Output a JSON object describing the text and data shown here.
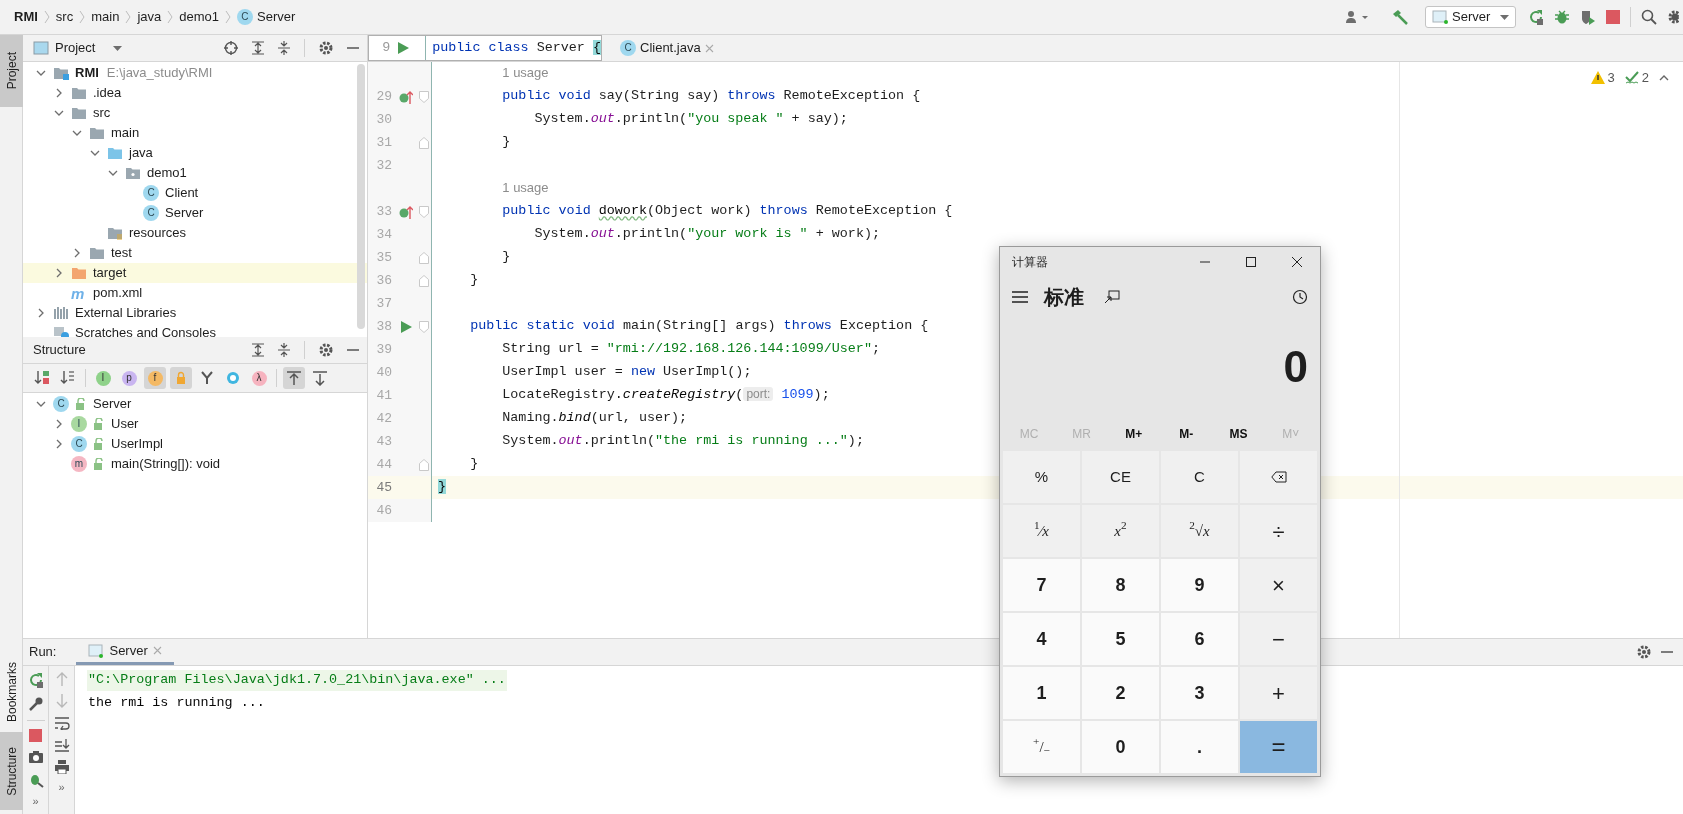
{
  "breadcrumbs": [
    {
      "text": "RMI",
      "kind": "project"
    },
    {
      "text": "src",
      "kind": "folder"
    },
    {
      "text": "main",
      "kind": "folder"
    },
    {
      "text": "java",
      "kind": "folder"
    },
    {
      "text": "demo1",
      "kind": "folder"
    },
    {
      "text": "Server",
      "kind": "class",
      "glyph": "C"
    }
  ],
  "toolbar": {
    "run_config": "Server"
  },
  "left_strip": {
    "top": [
      {
        "label": "Project",
        "selected": true
      }
    ],
    "bottom": [
      {
        "label": "Bookmarks",
        "selected": false
      },
      {
        "label": "Structure",
        "selected": true
      }
    ]
  },
  "project_panel": {
    "title": "Project",
    "tree": [
      {
        "text": "RMI",
        "kind": "project",
        "path": "E:\\java_study\\RMI",
        "expanded": true,
        "children": [
          {
            "text": ".idea",
            "kind": "folder",
            "expanded": false
          },
          {
            "text": "src",
            "kind": "folder",
            "expanded": true,
            "children": [
              {
                "text": "main",
                "kind": "folder",
                "expanded": true,
                "children": [
                  {
                    "text": "java",
                    "kind": "source",
                    "expanded": true,
                    "children": [
                      {
                        "text": "demo1",
                        "kind": "package",
                        "expanded": true,
                        "children": [
                          {
                            "text": "Client",
                            "kind": "class",
                            "glyph": "C"
                          },
                          {
                            "text": "Server",
                            "kind": "class",
                            "glyph": "C"
                          }
                        ]
                      }
                    ]
                  },
                  {
                    "text": "resources",
                    "kind": "resources"
                  }
                ]
              },
              {
                "text": "test",
                "kind": "folder",
                "expanded": false
              }
            ]
          },
          {
            "text": "target",
            "kind": "excluded",
            "expanded": false,
            "highlighted": true
          },
          {
            "text": "pom.xml",
            "kind": "maven",
            "glyph": "m"
          }
        ]
      },
      {
        "text": "External Libraries",
        "kind": "libraries",
        "expanded": false
      },
      {
        "text": "Scratches and Consoles",
        "kind": "scratches"
      }
    ]
  },
  "structure_panel": {
    "title": "Structure",
    "tools": [
      {
        "kind": "sort-visibility",
        "on": false
      },
      {
        "kind": "sort-alpha",
        "on": false
      },
      {
        "kind": "inherited",
        "glyph": "I",
        "on": false
      },
      {
        "kind": "property",
        "glyph": "p",
        "on": false
      },
      {
        "kind": "fields",
        "glyph": "f",
        "on": true
      },
      {
        "kind": "non-public",
        "on": true
      },
      {
        "kind": "fork",
        "on": false
      },
      {
        "kind": "anonymous",
        "on": false
      },
      {
        "kind": "lambda",
        "glyph": "λ",
        "on": false
      },
      {
        "kind": "autoscroll-to",
        "on": true
      },
      {
        "kind": "autoscroll-from",
        "on": false
      }
    ],
    "tree": [
      {
        "text": "Server",
        "kind": "class",
        "glyph": "C",
        "expanded": true,
        "children": [
          {
            "text": "User",
            "kind": "interface",
            "glyph": "I",
            "expanded": false
          },
          {
            "text": "UserImpl",
            "kind": "class",
            "glyph": "C",
            "expanded": false
          },
          {
            "text": "main(String[]): void",
            "kind": "method",
            "glyph": "m"
          }
        ]
      }
    ]
  },
  "editor": {
    "sticky": {
      "number": "9",
      "marker": {
        "kind": "run"
      },
      "tokens": [
        {
          "text": "public",
          "kind": "keyword"
        },
        {
          "text": " class",
          "kind": "keyword"
        },
        {
          "text": " Server ",
          "kind": "plain"
        },
        {
          "text": "{",
          "kind": "brace"
        }
      ]
    },
    "tabs": [
      {
        "label": "Client.java",
        "glyph": "C",
        "selected": false
      }
    ],
    "warnings": "3",
    "passed": "2",
    "lines": [
      {
        "kind": "usage",
        "tokens": [
          {
            "text": "        1 usage",
            "kind": "usage"
          }
        ]
      },
      {
        "kind": "code",
        "number": "29",
        "marker": {
          "kind": "implements"
        },
        "fold": {
          "kind": "start"
        },
        "tokens": [
          {
            "text": "        public",
            "kind": "keyword"
          },
          {
            "text": " void",
            "kind": "keyword"
          },
          {
            "text": " say(String say) ",
            "kind": "plain"
          },
          {
            "text": "throws",
            "kind": "keyword"
          },
          {
            "text": " RemoteException {",
            "kind": "plain"
          }
        ]
      },
      {
        "kind": "code",
        "number": "30",
        "tokens": [
          {
            "text": "            System.",
            "kind": "plain"
          },
          {
            "text": "out",
            "kind": "field"
          },
          {
            "text": ".println(",
            "kind": "plain"
          },
          {
            "text": "\"you speak \"",
            "kind": "string"
          },
          {
            "text": " + say);",
            "kind": "plain"
          }
        ]
      },
      {
        "kind": "code",
        "number": "31",
        "fold": {
          "kind": "end"
        },
        "tokens": [
          {
            "text": "        }",
            "kind": "plain"
          }
        ]
      },
      {
        "kind": "code",
        "number": "32"
      },
      {
        "kind": "usage",
        "tokens": [
          {
            "text": "        1 usage",
            "kind": "usage"
          }
        ]
      },
      {
        "kind": "code",
        "number": "33",
        "marker": {
          "kind": "implements"
        },
        "fold": {
          "kind": "start"
        },
        "tokens": [
          {
            "text": "        public",
            "kind": "keyword"
          },
          {
            "text": " void",
            "kind": "keyword"
          },
          {
            "text": " dowork",
            "kind": "typo"
          },
          {
            "text": "(Object work) ",
            "kind": "plain"
          },
          {
            "text": "throws",
            "kind": "keyword"
          },
          {
            "text": " RemoteException {",
            "kind": "plain"
          }
        ]
      },
      {
        "kind": "code",
        "number": "34",
        "tokens": [
          {
            "text": "            System.",
            "kind": "plain"
          },
          {
            "text": "out",
            "kind": "field"
          },
          {
            "text": ".println(",
            "kind": "plain"
          },
          {
            "text": "\"your work is \"",
            "kind": "string"
          },
          {
            "text": " + work);",
            "kind": "plain"
          }
        ]
      },
      {
        "kind": "code",
        "number": "35",
        "fold": {
          "kind": "end"
        },
        "tokens": [
          {
            "text": "        }",
            "kind": "plain"
          }
        ]
      },
      {
        "kind": "code",
        "number": "36",
        "fold": {
          "kind": "end"
        },
        "tokens": [
          {
            "text": "    }",
            "kind": "plain"
          }
        ]
      },
      {
        "kind": "code",
        "number": "37"
      },
      {
        "kind": "code",
        "number": "38",
        "marker": {
          "kind": "run"
        },
        "fold": {
          "kind": "start"
        },
        "tokens": [
          {
            "text": "    public",
            "kind": "keyword"
          },
          {
            "text": " static",
            "kind": "keyword"
          },
          {
            "text": " void",
            "kind": "keyword"
          },
          {
            "text": " main(String[] args) ",
            "kind": "plain"
          },
          {
            "text": "throws",
            "kind": "keyword"
          },
          {
            "text": " Exception {",
            "kind": "plain"
          }
        ]
      },
      {
        "kind": "code",
        "number": "39",
        "tokens": [
          {
            "text": "        String url = ",
            "kind": "plain"
          },
          {
            "text": "\"rmi://192.168.126.144:1099/User\"",
            "kind": "string"
          },
          {
            "text": ";",
            "kind": "plain"
          }
        ]
      },
      {
        "kind": "code",
        "number": "40",
        "tokens": [
          {
            "text": "        UserImpl user = ",
            "kind": "plain"
          },
          {
            "text": "new",
            "kind": "keyword"
          },
          {
            "text": " UserImpl();",
            "kind": "plain"
          }
        ]
      },
      {
        "kind": "code",
        "number": "41",
        "tokens": [
          {
            "text": "        LocateRegistry.",
            "kind": "plain"
          },
          {
            "text": "createRegistry",
            "kind": "static"
          },
          {
            "text": "(",
            "kind": "plain"
          },
          {
            "text": "port:",
            "kind": "hint"
          },
          {
            "text": " 1099",
            "kind": "number"
          },
          {
            "text": ");",
            "kind": "plain"
          }
        ]
      },
      {
        "kind": "code",
        "number": "42",
        "tokens": [
          {
            "text": "        Naming.",
            "kind": "plain"
          },
          {
            "text": "bind",
            "kind": "static"
          },
          {
            "text": "(url, user);",
            "kind": "plain"
          }
        ]
      },
      {
        "kind": "code",
        "number": "43",
        "tokens": [
          {
            "text": "        System.",
            "kind": "plain"
          },
          {
            "text": "out",
            "kind": "field"
          },
          {
            "text": ".println(",
            "kind": "plain"
          },
          {
            "text": "\"the rmi is running ...\"",
            "kind": "string"
          },
          {
            "text": ");",
            "kind": "plain"
          }
        ]
      },
      {
        "kind": "code",
        "number": "44",
        "fold": {
          "kind": "end"
        },
        "tokens": [
          {
            "text": "    }",
            "kind": "plain"
          }
        ]
      },
      {
        "kind": "code",
        "number": "45",
        "current": true,
        "tokens": [
          {
            "text": "}",
            "kind": "brace"
          }
        ]
      },
      {
        "kind": "code",
        "number": "46"
      }
    ]
  },
  "run_panel": {
    "title": "Run:",
    "tabs": [
      {
        "label": "Server",
        "selected": true
      }
    ],
    "more": [
      "»",
      "»"
    ],
    "console": [
      {
        "text": "\"C:\\Program Files\\Java\\jdk1.7.0_21\\bin\\java.exe\" ...",
        "kind": "command"
      },
      {
        "text": "the rmi is running ...",
        "kind": "output"
      }
    ]
  },
  "calculator": {
    "title": "计算器",
    "mode": "标准",
    "display": "0",
    "memory": [
      {
        "label": "MC",
        "disabled": true
      },
      {
        "label": "MR",
        "disabled": true
      },
      {
        "label": "M+",
        "disabled": false
      },
      {
        "label": "M-",
        "disabled": false
      },
      {
        "label": "MS",
        "disabled": false
      },
      {
        "label": "M˅",
        "disabled": true
      }
    ],
    "keys": [
      {
        "label": "%",
        "kind": "function"
      },
      {
        "label": "CE",
        "kind": "function"
      },
      {
        "label": "C",
        "kind": "function"
      },
      {
        "kind": "backspace"
      },
      {
        "label": "$^{1}$⁄*x*",
        "kind": "function"
      },
      {
        "label": "*x*$^{2}$",
        "kind": "function"
      },
      {
        "label": "$^{2}$√*x*",
        "kind": "function"
      },
      {
        "label": "÷",
        "kind": "operator"
      },
      {
        "label": "7",
        "kind": "digit"
      },
      {
        "label": "8",
        "kind": "digit"
      },
      {
        "label": "9",
        "kind": "digit"
      },
      {
        "label": "×",
        "kind": "operator"
      },
      {
        "label": "4",
        "kind": "digit"
      },
      {
        "label": "5",
        "kind": "digit"
      },
      {
        "label": "6",
        "kind": "digit"
      },
      {
        "label": "−",
        "kind": "operator"
      },
      {
        "label": "1",
        "kind": "digit"
      },
      {
        "label": "2",
        "kind": "digit"
      },
      {
        "label": "3",
        "kind": "digit"
      },
      {
        "label": "+",
        "kind": "operator"
      },
      {
        "label": "$^{+}$/$_{−}$",
        "kind": "sign"
      },
      {
        "label": "0",
        "kind": "digit"
      },
      {
        "label": ".",
        "kind": "digit"
      },
      {
        "label": "=",
        "kind": "equals"
      }
    ]
  }
}
